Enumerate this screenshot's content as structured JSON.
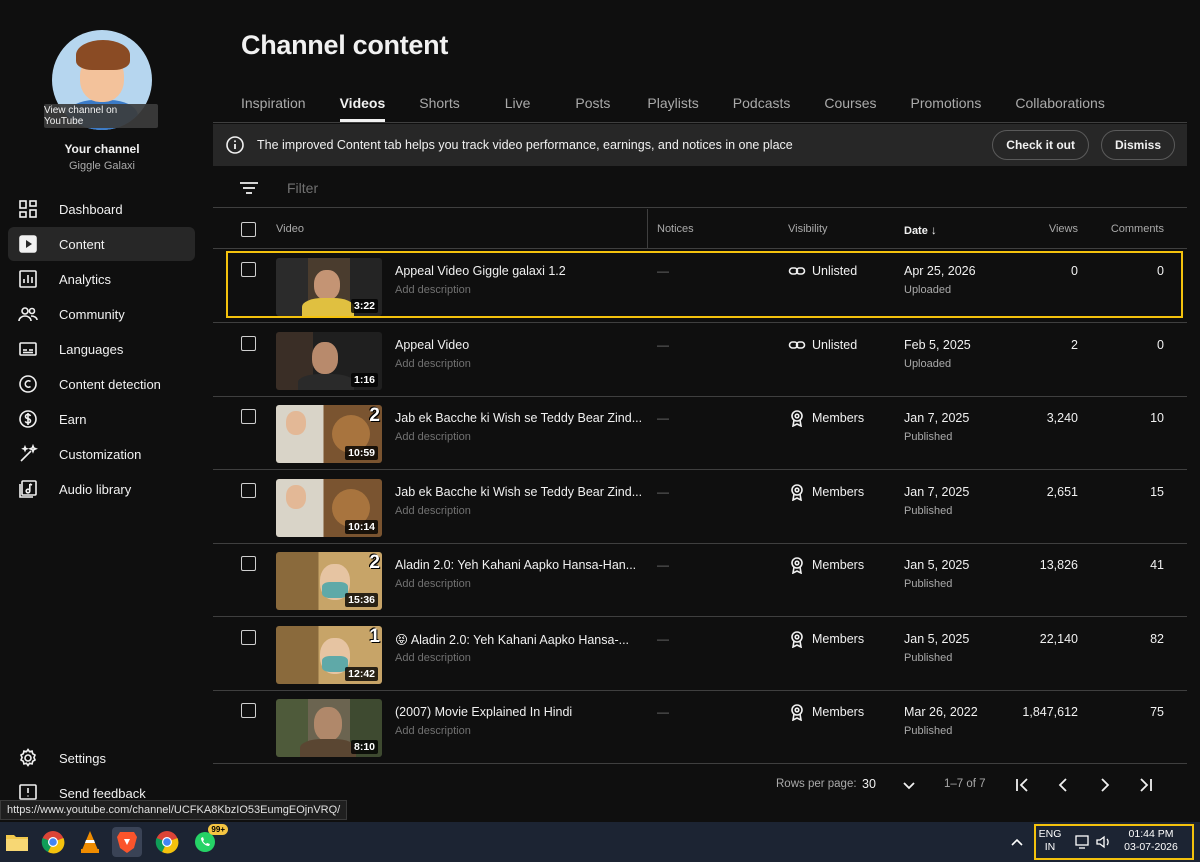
{
  "sidebar": {
    "view_channel": "View channel on YouTube",
    "your_channel": "Your channel",
    "channel_name": "Giggle Galaxi",
    "items": [
      {
        "label": "Dashboard",
        "icon": "dashboard-icon"
      },
      {
        "label": "Content",
        "icon": "content-icon",
        "active": true
      },
      {
        "label": "Analytics",
        "icon": "analytics-icon"
      },
      {
        "label": "Community",
        "icon": "community-icon"
      },
      {
        "label": "Languages",
        "icon": "languages-icon"
      },
      {
        "label": "Content detection",
        "icon": "copyright-icon"
      },
      {
        "label": "Earn",
        "icon": "dollar-icon"
      },
      {
        "label": "Customization",
        "icon": "magic-wand-icon"
      },
      {
        "label": "Audio library",
        "icon": "audio-library-icon"
      }
    ],
    "settings": "Settings",
    "feedback": "Send feedback"
  },
  "page_title": "Channel content",
  "tabs": [
    "Inspiration",
    "Videos",
    "Shorts",
    "Live",
    "Posts",
    "Playlists",
    "Podcasts",
    "Courses",
    "Promotions",
    "Collaborations"
  ],
  "active_tab": "Videos",
  "banner": {
    "text": "The improved Content tab helps you track video performance, earnings, and notices in one place",
    "check_label": "Check it out",
    "dismiss_label": "Dismiss"
  },
  "filter": {
    "placeholder": "Filter"
  },
  "table": {
    "columns": {
      "video": "Video",
      "notices": "Notices",
      "visibility": "Visibility",
      "date": "Date",
      "views": "Views",
      "comments": "Comments"
    },
    "rows": [
      {
        "title": "Appeal Video Giggle galaxi 1.2",
        "desc": "Add description",
        "duration": "3:22",
        "notices": "—",
        "visibility": "Unlisted",
        "date": "Apr 25, 2026",
        "status": "Uploaded",
        "views": "0",
        "comments": "0",
        "part": ""
      },
      {
        "title": "Appeal Video",
        "desc": "Add description",
        "duration": "1:16",
        "notices": "—",
        "visibility": "Unlisted",
        "date": "Feb 5, 2025",
        "status": "Uploaded",
        "views": "2",
        "comments": "0",
        "part": ""
      },
      {
        "title": "Jab ek Bacche ki Wish se Teddy Bear Zind...",
        "desc": "Add description",
        "duration": "10:59",
        "notices": "—",
        "visibility": "Members",
        "date": "Jan 7, 2025",
        "status": "Published",
        "views": "3,240",
        "comments": "10",
        "part": "2"
      },
      {
        "title": "Jab ek Bacche ki Wish se Teddy Bear Zind...",
        "desc": "Add description",
        "duration": "10:14",
        "notices": "—",
        "visibility": "Members",
        "date": "Jan 7, 2025",
        "status": "Published",
        "views": "2,651",
        "comments": "15",
        "part": ""
      },
      {
        "title": "Aladin 2.0: Yeh Kahani Aapko Hansa-Han...",
        "desc": "Add description",
        "duration": "15:36",
        "notices": "—",
        "visibility": "Members",
        "date": "Jan 5, 2025",
        "status": "Published",
        "views": "13,826",
        "comments": "41",
        "part": "2"
      },
      {
        "title": "😝 Aladin 2.0: Yeh Kahani Aapko Hansa-...",
        "desc": "Add description",
        "duration": "12:42",
        "notices": "—",
        "visibility": "Members",
        "date": "Jan 5, 2025",
        "status": "Published",
        "views": "22,140",
        "comments": "82",
        "part": "1"
      },
      {
        "title": "(2007) Movie Explained In Hindi",
        "desc": "Add description",
        "duration": "8:10",
        "notices": "—",
        "visibility": "Members",
        "date": "Mar 26, 2022",
        "status": "Published",
        "views": "1,847,612",
        "comments": "75",
        "part": ""
      }
    ]
  },
  "pager": {
    "rows_per_page_label": "Rows per page:",
    "rows_per_page": "30",
    "range": "1–7 of 7"
  },
  "status_url": "https://www.youtube.com/channel/UCFKA8KbzIO53EumgEOjnVRQ/",
  "taskbar": {
    "whatsapp_badge": "99+",
    "lang_top": "ENG",
    "lang_bottom": "IN",
    "time": "01:44 PM",
    "date": "03-07-2026"
  },
  "colors": {
    "background": "#0f0f0f",
    "highlight": "#f4c20d",
    "taskbar": "#1c2433"
  }
}
